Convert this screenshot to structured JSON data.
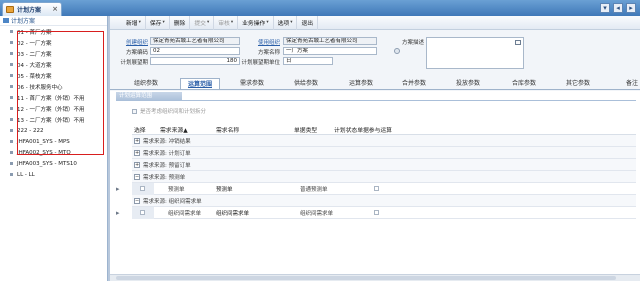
{
  "window": {
    "tab_title": "计划方案",
    "close_glyph": "×",
    "controls": [
      "▾",
      "◂",
      "▸"
    ]
  },
  "tree": {
    "root_label": "计划方案",
    "items": [
      {
        "label": "01 - 首厂方案"
      },
      {
        "label": "02 - 一厂方案"
      },
      {
        "label": "03 - 二厂方案"
      },
      {
        "label": "04 - 大道方案"
      },
      {
        "label": "05 - 菜枝方案"
      },
      {
        "label": "06 - 技术服务中心"
      },
      {
        "label": "11 - 首厂方案（外销）不用"
      },
      {
        "label": "12 - 一厂方案（外销）不用"
      },
      {
        "label": "13 - 二厂方案（外销）不用"
      },
      {
        "label": "222 - 222"
      },
      {
        "label": "JHFA001_SYS - MPS"
      },
      {
        "label": "JHFA002_SYS - MTO"
      },
      {
        "label": "JHFA003_SYS - MTS10"
      },
      {
        "label": "LL - LL"
      }
    ]
  },
  "toolbar": {
    "buttons": [
      {
        "label": "新增",
        "caret": "▾",
        "disabled": false
      },
      {
        "label": "保存",
        "caret": "▾",
        "disabled": false
      },
      {
        "label": "删除",
        "caret": "",
        "disabled": false
      },
      {
        "label": "提交",
        "caret": "▾",
        "disabled": true
      },
      {
        "label": "审核",
        "caret": "▾",
        "disabled": true
      },
      {
        "label": "业务操作",
        "caret": "▾",
        "disabled": false
      },
      {
        "label": "选项",
        "caret": "▾",
        "disabled": false
      },
      {
        "label": "退出",
        "caret": "",
        "disabled": false
      }
    ]
  },
  "form": {
    "create_org_label": "创建组织",
    "create_org_value": "保定青苑古城工艺者有限公司",
    "use_org_label": "使用组织",
    "use_org_value": "保定青苑古城工艺者有限公司",
    "plan_desc_label": "方案描述",
    "code_label": "方案编码",
    "code_value": "02",
    "name_label": "方案名称",
    "name_value": "一厂方案",
    "horizon_label": "计划展望期",
    "horizon_value": "180",
    "horizon_unit_label": "计划展望期单位",
    "horizon_unit_value": "日"
  },
  "param_tabs": [
    {
      "label": "组织参数",
      "active": false
    },
    {
      "label": "运算范围",
      "active": true
    },
    {
      "label": "需求参数",
      "active": false
    },
    {
      "label": "供给参数",
      "active": false
    },
    {
      "label": "运算参数",
      "active": false
    },
    {
      "label": "合并参数",
      "active": false
    },
    {
      "label": "投放参数",
      "active": false
    },
    {
      "label": "合库参数",
      "active": false
    },
    {
      "label": "其它参数",
      "active": false
    },
    {
      "label": "备注",
      "active": false
    }
  ],
  "scope": {
    "section_title": "计划运算范围",
    "check_label": "是否考虑组织间和计划拆分",
    "columns": {
      "select": "选择",
      "source": "需求来源▲",
      "demand_name": "需求名称",
      "doc_type": "单据类型",
      "by_status": "计划状态单据参与运算"
    },
    "groups": [
      {
        "label": "需求来源: 冲销结果",
        "expander": "+"
      },
      {
        "label": "需求来源: 计划订单",
        "expander": "+"
      },
      {
        "label": "需求来源: 预留订单",
        "expander": "+"
      },
      {
        "label": "需求来源: 预测单",
        "expander": "−"
      },
      {
        "label": "需求来源: 组织间需求单",
        "expander": "−"
      }
    ],
    "rows": [
      {
        "source": "预测单",
        "demand_name": "预测单",
        "doc_type": "普通预测单"
      },
      {
        "source": "组织间需求单",
        "demand_name": "组织间需求单",
        "doc_type": "组织间需求单"
      }
    ],
    "row_arrow": "▸"
  }
}
